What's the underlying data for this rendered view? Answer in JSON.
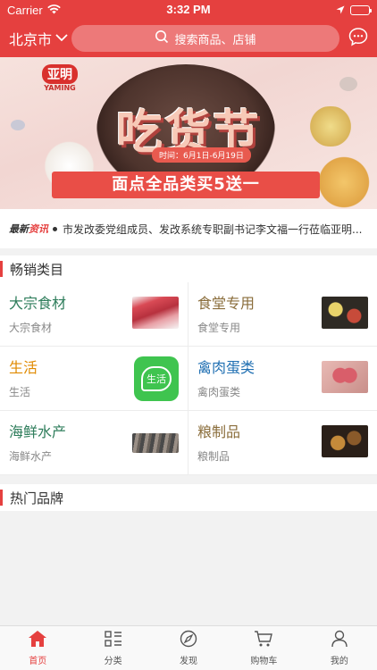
{
  "status": {
    "carrier": "Carrier",
    "time": "3:32 PM"
  },
  "header": {
    "city": "北京市",
    "search_placeholder": "搜索商品、店铺"
  },
  "banner": {
    "brand": "亚明",
    "brand_en": "YAMING",
    "title": "吃货节",
    "time": "时间：6月1日-6月19日",
    "slogan": "面点全品类买5送一"
  },
  "news": {
    "tag_a": "最新",
    "tag_b": "资讯",
    "text": "市发改委党组成员、发改系统专职副书记李文福一行莅临亚明..."
  },
  "categories_title": "畅销类目",
  "categories": [
    {
      "name": "大宗食材",
      "sub": "大宗食材",
      "color": "#2e7d5b",
      "thumb": "meat"
    },
    {
      "name": "食堂专用",
      "sub": "食堂专用",
      "color": "#8a6d3b",
      "thumb": "food"
    },
    {
      "name": "生活",
      "sub": "生活",
      "color": "#e08a00",
      "thumb": "life"
    },
    {
      "name": "禽肉蛋类",
      "sub": "禽肉蛋类",
      "color": "#1f6fb2",
      "thumb": "egg"
    },
    {
      "name": "海鲜水产",
      "sub": "海鲜水产",
      "color": "#2e7d5b",
      "thumb": "seafood"
    },
    {
      "name": "粮制品",
      "sub": "粮制品",
      "color": "#8a6d3b",
      "thumb": "grain"
    }
  ],
  "life_icon_text": "生活",
  "brands_title": "热门品牌",
  "tabs": [
    {
      "label": "首页",
      "icon": "home-icon",
      "active": true
    },
    {
      "label": "分类",
      "icon": "category-icon",
      "active": false
    },
    {
      "label": "发现",
      "icon": "compass-icon",
      "active": false
    },
    {
      "label": "购物车",
      "icon": "cart-icon",
      "active": false
    },
    {
      "label": "我的",
      "icon": "user-icon",
      "active": false
    }
  ],
  "colors": {
    "accent": "#e5403f"
  }
}
